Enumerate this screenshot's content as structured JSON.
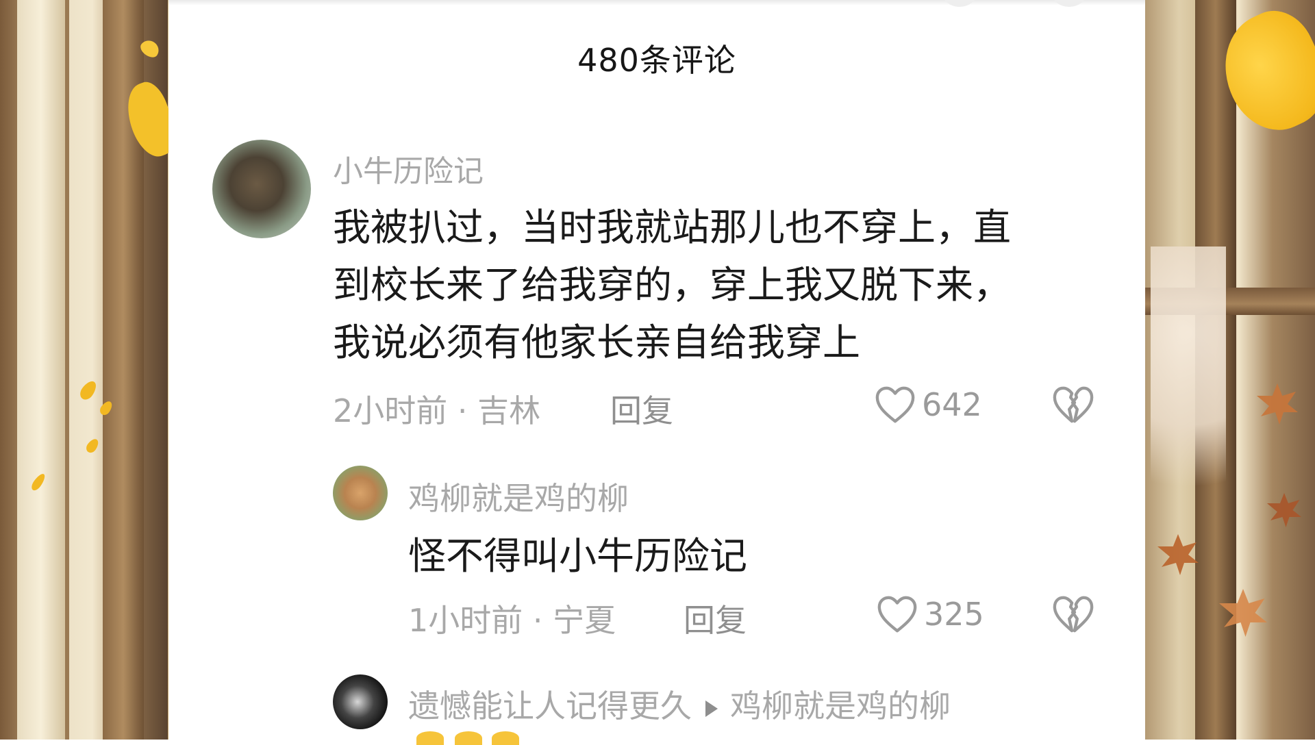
{
  "header": {
    "comment_count": "480条评论"
  },
  "comments": [
    {
      "username": "小牛历险记",
      "text_lines": [
        "我被扒过，当时我就站那儿也不穿上，直",
        "到校长来了给我穿的，穿上我又脱下来，",
        "我说必须有他家长亲自给我穿上"
      ],
      "meta": "2小时前 · 吉林",
      "reply_label": "回复",
      "likes": "642"
    },
    {
      "username": "鸡柳就是鸡的柳",
      "text_lines": [
        "怪不得叫小牛历险记"
      ],
      "meta": "1小时前 · 宁夏",
      "reply_label": "回复",
      "likes": "325"
    },
    {
      "username": "遗憾能让人记得更久",
      "reply_to": "鸡柳就是鸡的柳"
    }
  ],
  "icons": {
    "like": "heart-outline-icon",
    "dislike": "broken-heart-icon",
    "reply_arrow": "triangle-right-icon"
  },
  "colors": {
    "panel_bg": "#ffffff",
    "text_primary": "#1a1a1a",
    "text_secondary": "#a8a8a8"
  }
}
